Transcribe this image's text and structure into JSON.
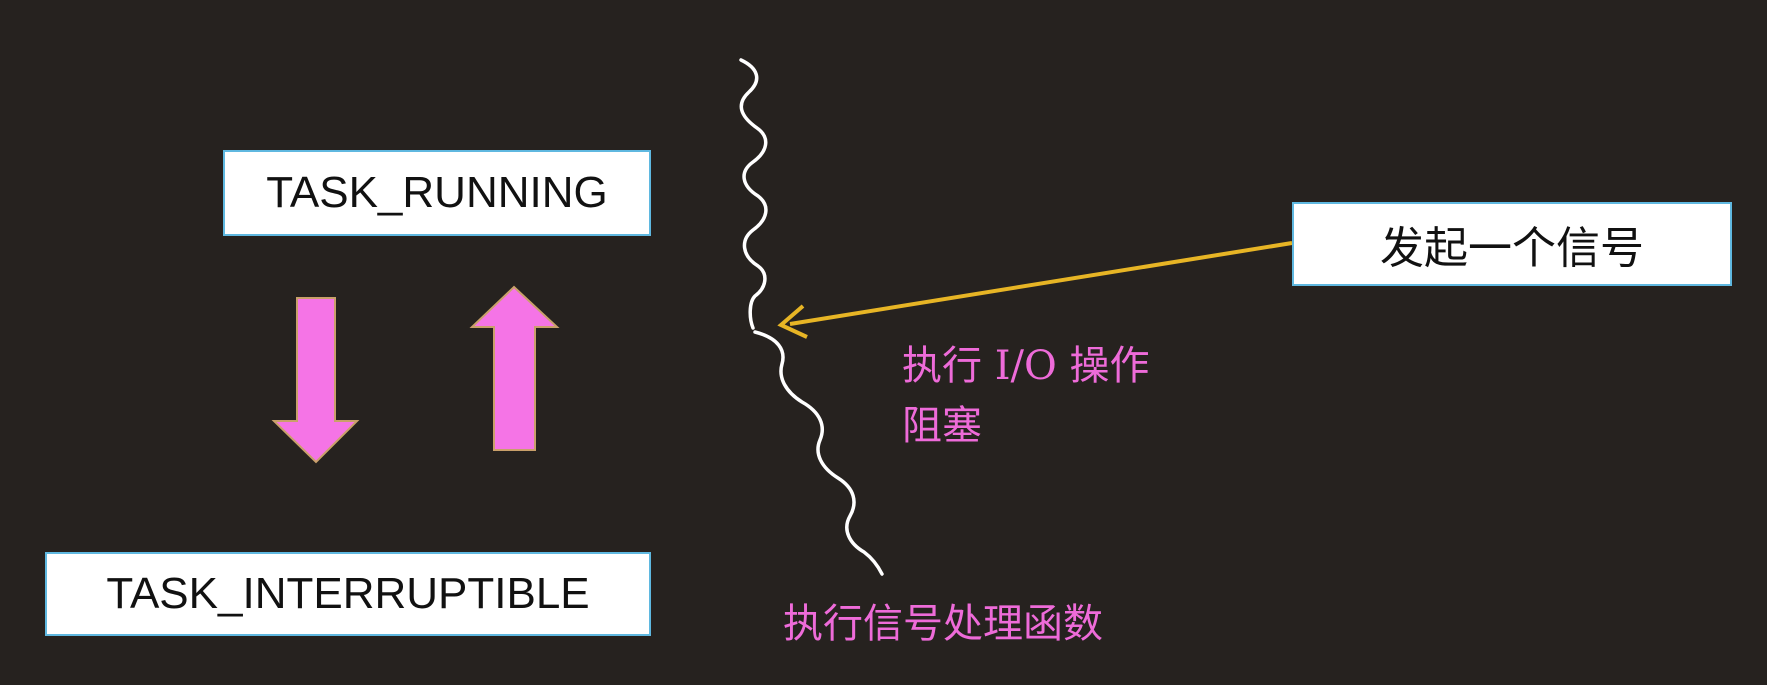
{
  "states": {
    "running": "TASK_RUNNING",
    "interruptible": "TASK_INTERRUPTIBLE"
  },
  "signal_box": "发起一个信号",
  "captions": {
    "io_operation": "执行 I/O 操作",
    "blocked": "阻塞",
    "signal_handler": "执行信号处理函数"
  },
  "colors": {
    "background": "#26221f",
    "state_arrows": "#f574e6",
    "signal_arrow": "#e7b525",
    "wavy_line": "#ffffff",
    "caption_text": "#ee6bd9",
    "box_border": "#5fb8e0"
  }
}
